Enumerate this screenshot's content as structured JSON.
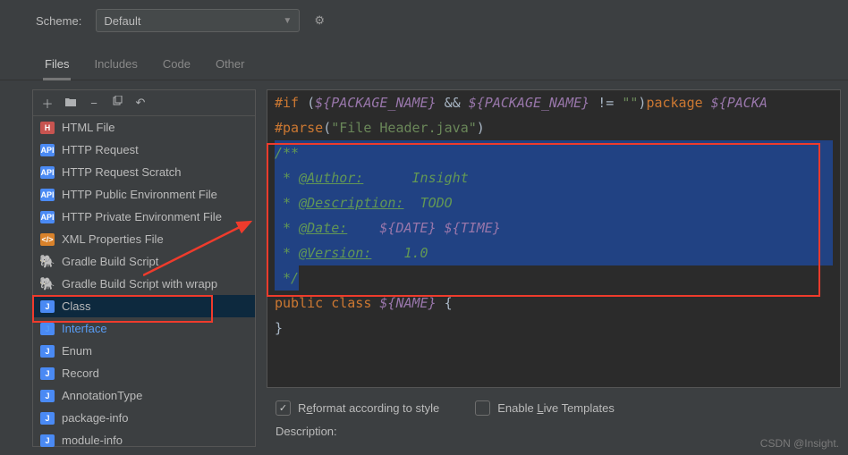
{
  "scheme": {
    "label": "Scheme:",
    "value": "Default"
  },
  "tabs": [
    "Files",
    "Includes",
    "Code",
    "Other"
  ],
  "active_tab": 0,
  "toolbar_icons": [
    "plus-icon",
    "new-folder-icon",
    "remove-icon",
    "copy-icon",
    "undo-icon"
  ],
  "list": [
    {
      "icon": "html",
      "label": "HTML File"
    },
    {
      "icon": "api",
      "label": "HTTP Request"
    },
    {
      "icon": "api",
      "label": "HTTP Request Scratch"
    },
    {
      "icon": "api",
      "label": "HTTP Public Environment File"
    },
    {
      "icon": "api",
      "label": "HTTP Private Environment File"
    },
    {
      "icon": "xml",
      "label": "XML Properties File"
    },
    {
      "icon": "gradle",
      "label": "Gradle Build Script"
    },
    {
      "icon": "gradle",
      "label": "Gradle Build Script with wrapp"
    },
    {
      "icon": "java",
      "label": "Class",
      "selected": true
    },
    {
      "icon": "java",
      "label": "Interface",
      "link": true
    },
    {
      "icon": "java",
      "label": "Enum"
    },
    {
      "icon": "java",
      "label": "Record"
    },
    {
      "icon": "java",
      "label": "AnnotationType"
    },
    {
      "icon": "java",
      "label": "package-info"
    },
    {
      "icon": "java",
      "label": "module-info"
    }
  ],
  "editor": {
    "line1": {
      "a": "#if",
      "b": " (",
      "c": "${PACKAGE_NAME}",
      "d": " && ",
      "e": "${PACKAGE_NAME}",
      "f": " != ",
      "g": "\"\"",
      "h": ")",
      "i": "package ",
      "j": "${PACKA"
    },
    "line2": {
      "a": "#parse",
      "b": "(",
      "c": "\"File Header.java\"",
      "d": ")"
    },
    "comment_open": "/**",
    "c1": {
      "star": " * ",
      "tag": "@Author:",
      "pad": "      ",
      "val": "Insight"
    },
    "c2": {
      "star": " * ",
      "tag": "@Description:",
      "pad": "  ",
      "val": "TODO"
    },
    "c3": {
      "star": " * ",
      "tag": "@Date:",
      "pad": "    ",
      "val1": "${DATE}",
      "sp": " ",
      "val2": "${TIME}"
    },
    "c4": {
      "star": " * ",
      "tag": "@Version:",
      "pad": "    ",
      "val": "1.0"
    },
    "comment_close": " */",
    "decl": {
      "a": "public class ",
      "b": "${NAME}",
      "c": " {"
    },
    "close": "}"
  },
  "options": {
    "reformat": {
      "pre": "R",
      "u": "e",
      "post": "format according to style",
      "checked": true
    },
    "live": {
      "pre": "Enable ",
      "u": "L",
      "post": "ive Templates",
      "checked": false
    }
  },
  "description_label": "Description:",
  "watermark": "CSDN @Insight."
}
